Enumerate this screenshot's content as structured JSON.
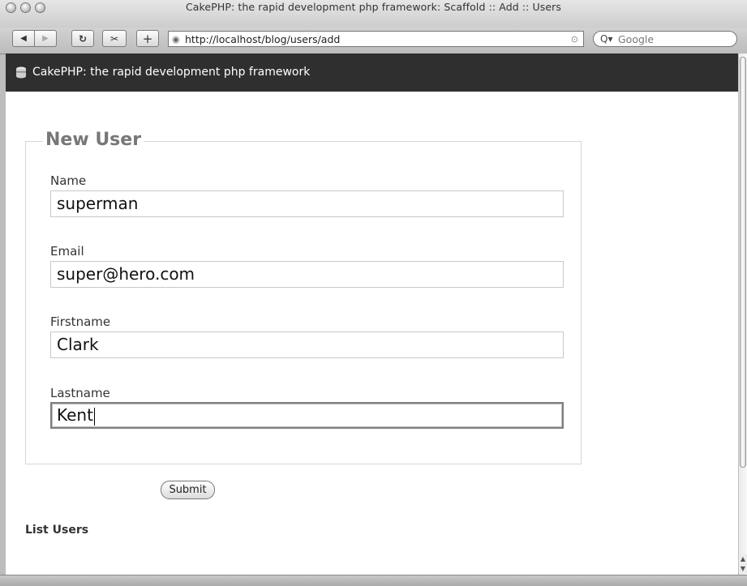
{
  "window": {
    "title": "CakePHP: the rapid development php framework: Scaffold :: Add :: Users"
  },
  "toolbar": {
    "back_icon": "back-arrow-icon",
    "forward_icon": "forward-arrow-icon",
    "reload_icon": "reload-icon",
    "snippet_icon": "snippet-icon",
    "add_icon": "plus-icon",
    "url": "http://localhost/blog/users/add",
    "search_placeholder": "Google"
  },
  "header": {
    "title": "CakePHP: the rapid development php framework"
  },
  "form": {
    "legend": "New User",
    "fields": [
      {
        "label": "Name",
        "value": "superman"
      },
      {
        "label": "Email",
        "value": "super@hero.com"
      },
      {
        "label": "Firstname",
        "value": "Clark"
      },
      {
        "label": "Lastname",
        "value": "Kent"
      }
    ],
    "submit_label": "Submit"
  },
  "actions": {
    "list_users": "List Users"
  },
  "colors": {
    "header_bg": "#2f2f2f",
    "legend": "#777777"
  }
}
